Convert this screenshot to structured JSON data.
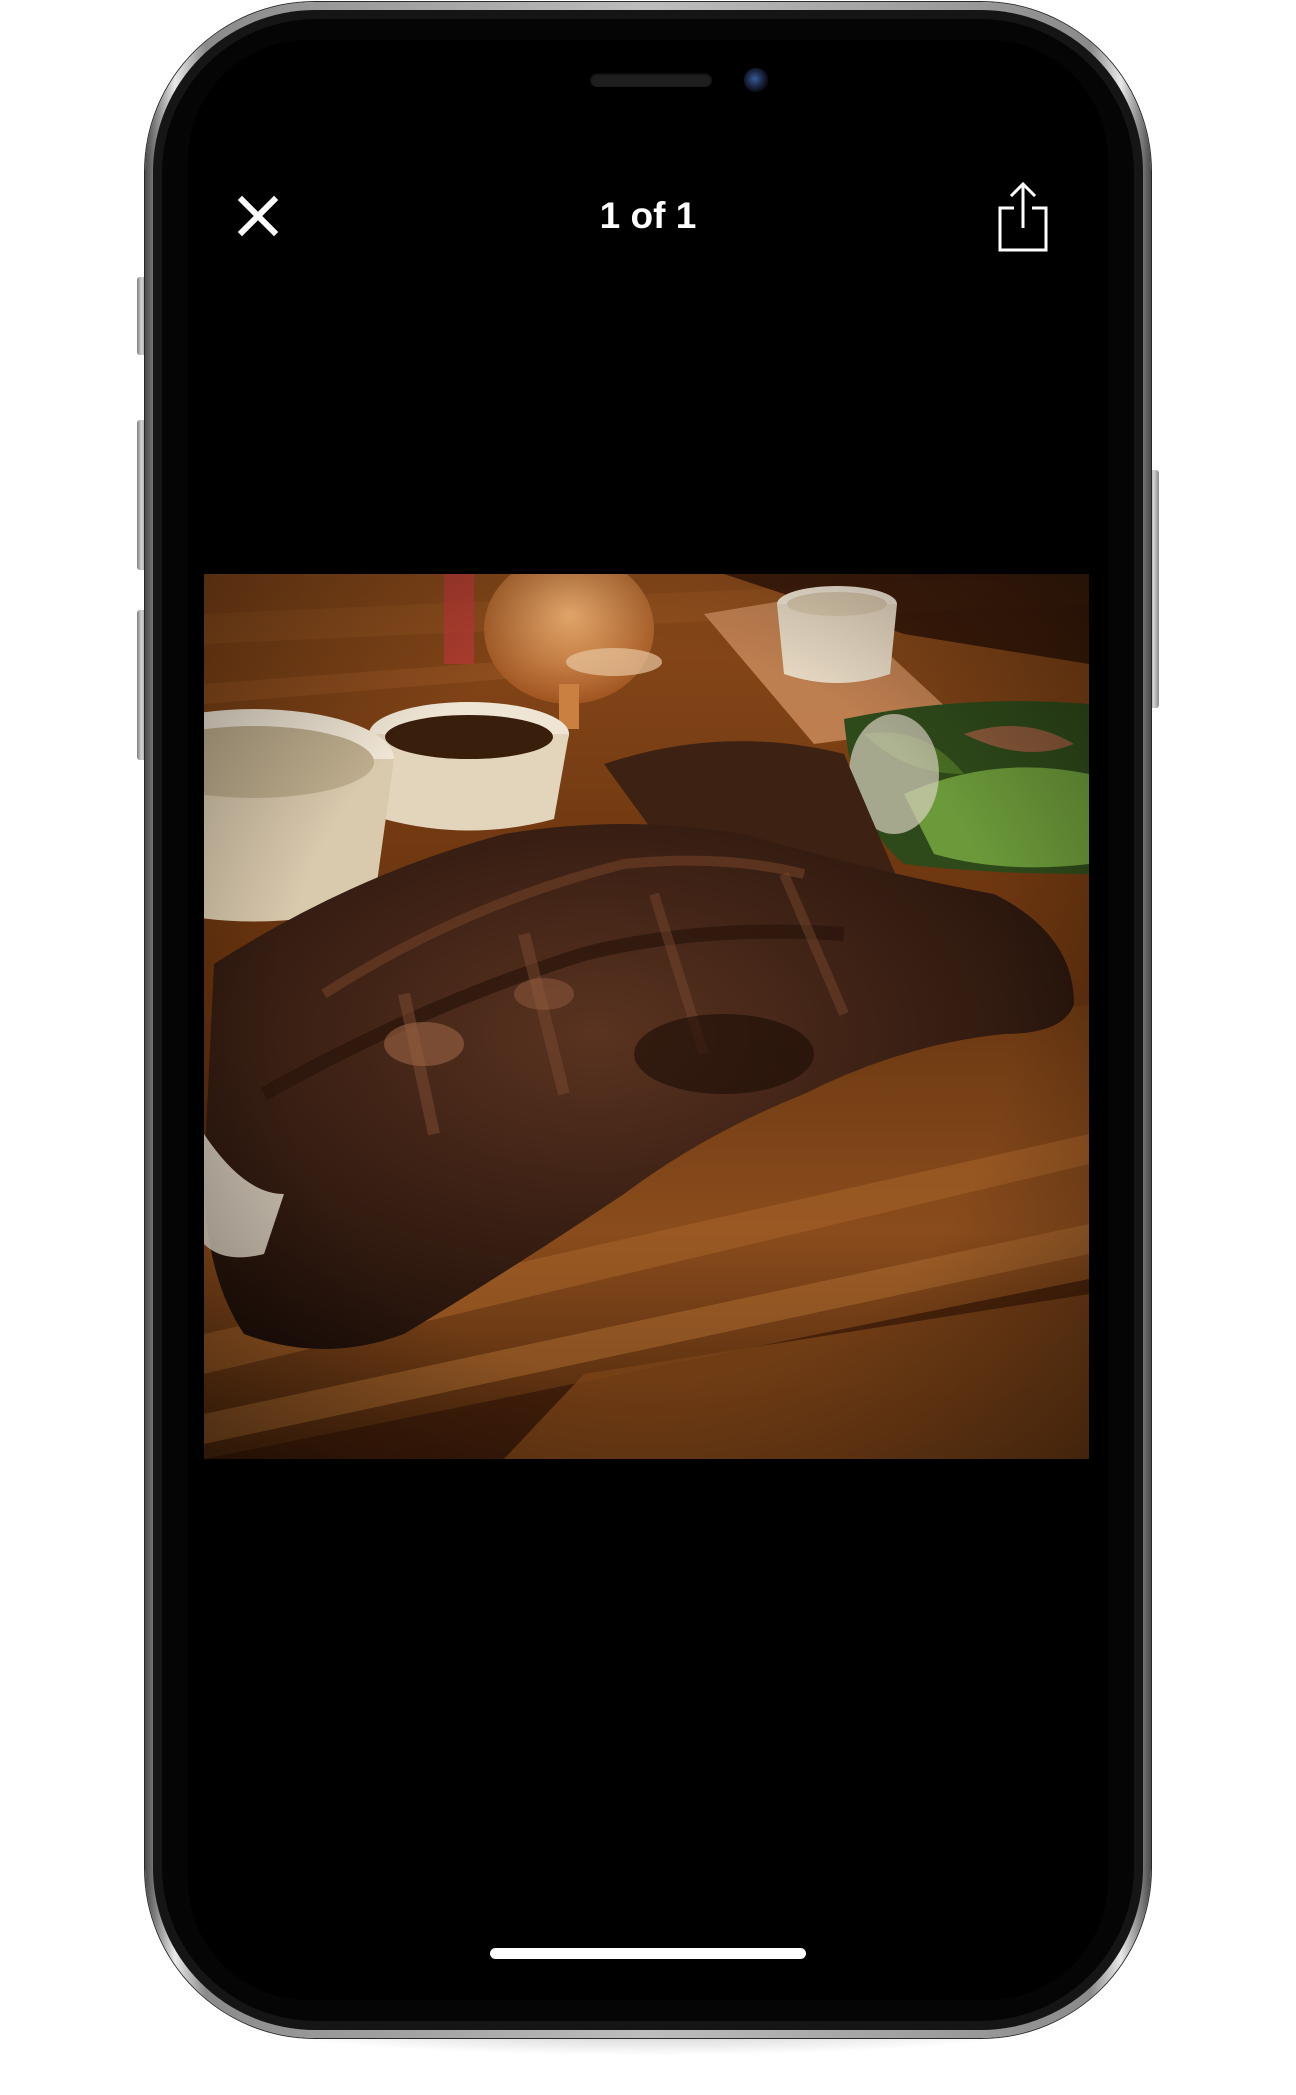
{
  "viewer": {
    "counter": "1 of 1",
    "close_icon": "close-icon",
    "share_icon": "share-icon"
  },
  "photo": {
    "subject_icon": "photo-of-grilled-ribs"
  },
  "colors": {
    "screen_background": "#000000",
    "foreground": "#ffffff"
  }
}
